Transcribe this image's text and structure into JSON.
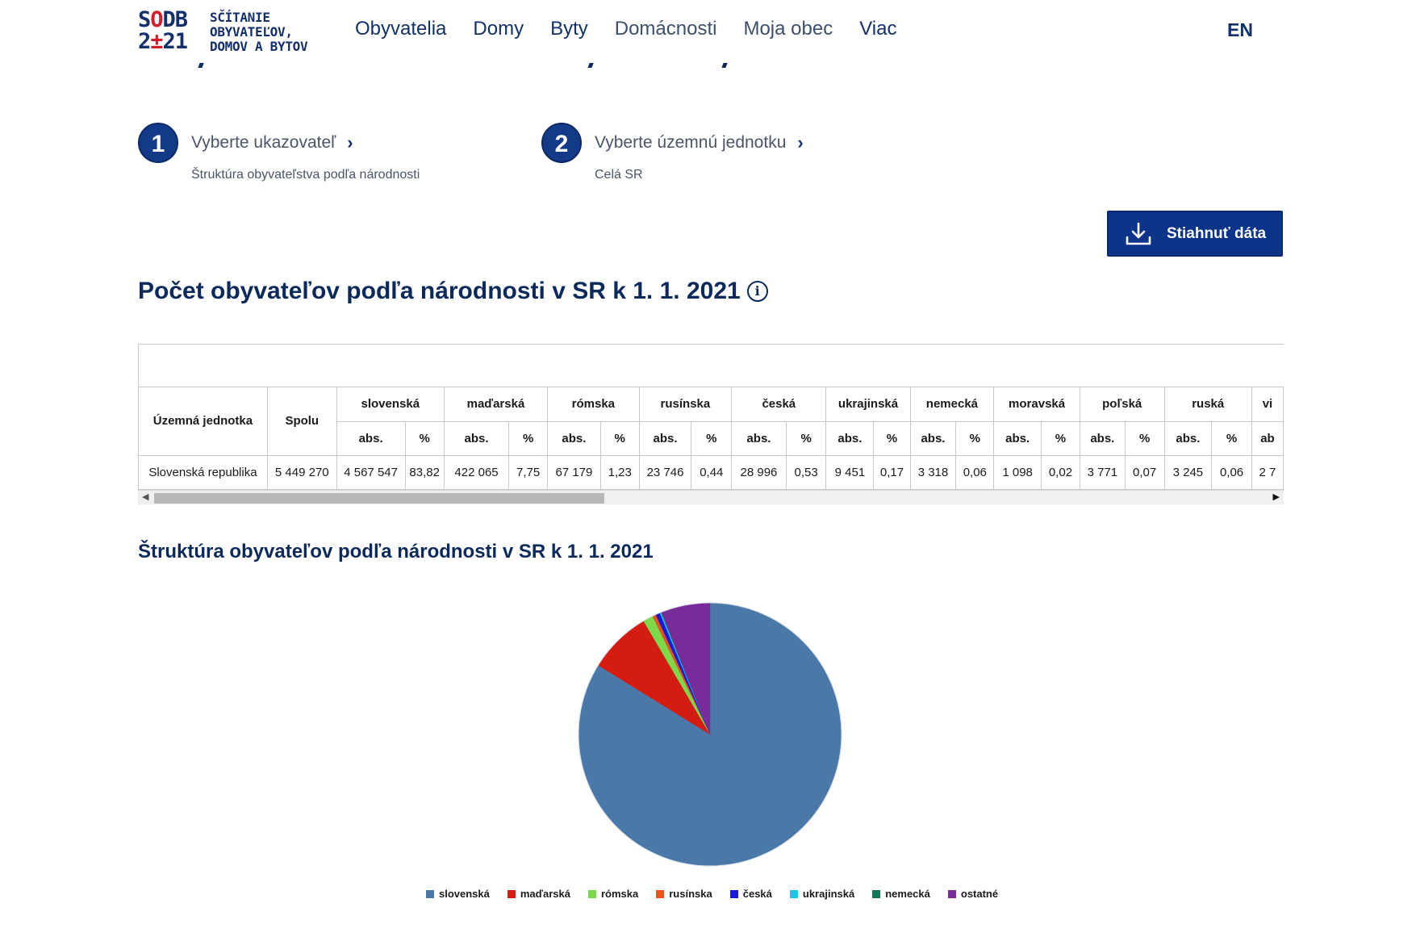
{
  "header": {
    "logo_mark_top": [
      "S",
      "O",
      "DB"
    ],
    "logo_mark_bottom": [
      "2",
      "±",
      "21"
    ],
    "logo_text": [
      "SČÍTANIE",
      "OBYVATEĽOV,",
      "DOMOV A BYTOV"
    ],
    "nav": [
      "Obyvatelia",
      "Domy",
      "Byty",
      "Domácnosti",
      "Moja obec",
      "Viac"
    ],
    "lang": "EN"
  },
  "steps": [
    {
      "num": "1",
      "title": "Vyberte ukazovateľ",
      "sub": "Štruktúra obyvateľstva podľa národnosti"
    },
    {
      "num": "2",
      "title": "Vyberte územnú jednotku",
      "sub": "Celá SR"
    }
  ],
  "download_label": "Stiahnuť dáta",
  "section_title": "Počet obyvateľov podľa národnosti v SR k 1. 1. 2021",
  "info_glyph": "i",
  "table": {
    "col_unit": "Územná jednotka",
    "col_total": "Spolu",
    "groups": [
      "slovenská",
      "maďarská",
      "rómska",
      "rusínska",
      "česká",
      "ukrajinská",
      "nemecká",
      "moravská",
      "poľská",
      "ruská",
      "vi"
    ],
    "sub_abs": "abs.",
    "sub_pct": "%",
    "sub_abs_cut": "ab",
    "row": {
      "unit": "Slovenská republika",
      "total": "5 449 270",
      "cells": [
        "4 567 547",
        "83,82",
        "422 065",
        "7,75",
        "67 179",
        "1,23",
        "23 746",
        "0,44",
        "28 996",
        "0,53",
        "9 451",
        "0,17",
        "3 318",
        "0,06",
        "1 098",
        "0,02",
        "3 771",
        "0,07",
        "3 245",
        "0,06",
        "2 7"
      ]
    }
  },
  "chart_data": {
    "type": "pie",
    "title": "Štruktúra obyvateľov podľa národnosti v SR k 1. 1. 2021",
    "categories": [
      "slovenská",
      "maďarská",
      "rómska",
      "rusínska",
      "česká",
      "ukrajinská",
      "nemecká",
      "ostatné"
    ],
    "values": [
      83.82,
      7.75,
      1.23,
      0.44,
      0.53,
      0.17,
      0.06,
      6.0
    ],
    "colors": [
      "#4a78a8",
      "#d41c13",
      "#7bd94a",
      "#e8531c",
      "#1a1ad6",
      "#1fc4e6",
      "#11785a",
      "#7a2b9a"
    ],
    "legend_position": "bottom"
  }
}
